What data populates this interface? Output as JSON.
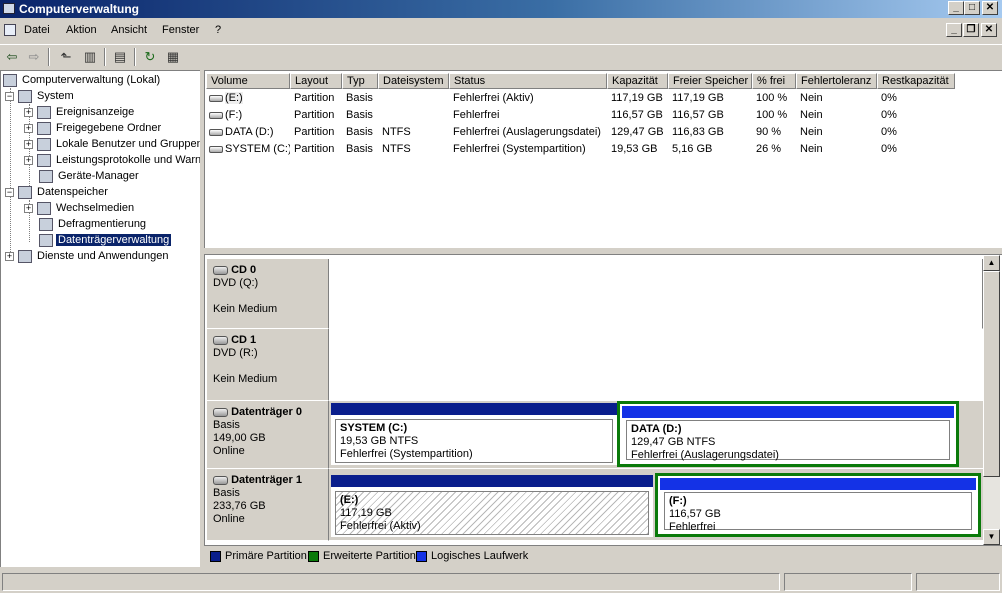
{
  "window": {
    "title": "Computerverwaltung"
  },
  "menu": [
    "Datei",
    "Aktion",
    "Ansicht",
    "Fenster",
    "?"
  ],
  "title_buttons": {
    "minimize": "_",
    "maximize": "□",
    "close": "✕"
  },
  "mdi_buttons": {
    "minimize": "_",
    "restore": "❐",
    "close": "✕"
  },
  "tree": {
    "root": "Computerverwaltung (Lokal)",
    "system": "System",
    "ereignis": "Ereignisanzeige",
    "freigaben": "Freigegebene Ordner",
    "benutzer": "Lokale Benutzer und Gruppen",
    "leistung": "Leistungsprotokolle und Warnungen",
    "geraete": "Geräte-Manager",
    "datenspeicher": "Datenspeicher",
    "wechselmedien": "Wechselmedien",
    "defrag": "Defragmentierung",
    "datentraeger": "Datenträgerverwaltung",
    "dienste": "Dienste und Anwendungen"
  },
  "volumes": {
    "headers": [
      "Volume",
      "Layout",
      "Typ",
      "Dateisystem",
      "Status",
      "Kapazität",
      "Freier Speicher",
      "% frei",
      "Fehlertoleranz",
      "Restkapazität"
    ],
    "rows": [
      [
        "(E:)",
        "Partition",
        "Basis",
        "",
        "Fehlerfrei (Aktiv)",
        "117,19 GB",
        "117,19 GB",
        "100 %",
        "Nein",
        "0%"
      ],
      [
        "(F:)",
        "Partition",
        "Basis",
        "",
        "Fehlerfrei",
        "116,57 GB",
        "116,57 GB",
        "100 %",
        "Nein",
        "0%"
      ],
      [
        "DATA (D:)",
        "Partition",
        "Basis",
        "NTFS",
        "Fehlerfrei (Auslagerungsdatei)",
        "129,47 GB",
        "116,83 GB",
        "90 %",
        "Nein",
        "0%"
      ],
      [
        "SYSTEM (C:)",
        "Partition",
        "Basis",
        "NTFS",
        "Fehlerfrei (Systempartition)",
        "19,53 GB",
        "5,16 GB",
        "26 %",
        "Nein",
        "0%"
      ]
    ]
  },
  "disks": {
    "cd0": {
      "name": "CD 0",
      "type": "DVD (Q:)",
      "status": "Kein Medium"
    },
    "cd1": {
      "name": "CD 1",
      "type": "DVD (R:)",
      "status": "Kein Medium"
    },
    "disk0": {
      "name": "Datenträger 0",
      "type": "Basis",
      "size": "149,00 GB",
      "status": "Online",
      "partitions": [
        {
          "name": "SYSTEM  (C:)",
          "size": "19,53 GB NTFS",
          "status": "Fehlerfrei (Systempartition)"
        },
        {
          "name": "DATA  (D:)",
          "size": "129,47 GB NTFS",
          "status": "Fehlerfrei (Auslagerungsdatei)"
        }
      ]
    },
    "disk1": {
      "name": "Datenträger 1",
      "type": "Basis",
      "size": "233,76 GB",
      "status": "Online",
      "partitions": [
        {
          "name": "(E:)",
          "size": "117,19 GB",
          "status": "Fehlerfrei (Aktiv)"
        },
        {
          "name": "(F:)",
          "size": "116,57 GB",
          "status": "Fehlerfrei"
        }
      ]
    }
  },
  "legend": [
    "Primäre Partition",
    "Erweiterte Partition",
    "Logisches Laufwerk"
  ],
  "colors": {
    "primary": "#0a1e8c",
    "extended": "#0a7a0a",
    "logical": "#1432e6",
    "selection": "#0a246a"
  },
  "icons": {
    "toolbar": [
      "back-icon",
      "forward-icon",
      "up-icon",
      "show-tree-icon",
      "properties-icon",
      "refresh-icon",
      "export-icon"
    ]
  }
}
